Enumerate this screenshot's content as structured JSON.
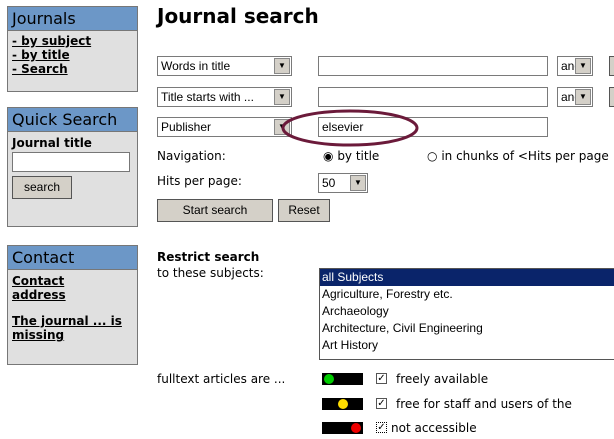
{
  "sidebar": {
    "journals_title": "Journals",
    "journals_links": [
      "- by subject",
      "- by title",
      "- Search"
    ],
    "quick_title": "Quick Search",
    "quick_label": "Journal title",
    "quick_button": "search",
    "contact_title": "Contact",
    "contact_link1": "Contact address",
    "contact_link2": "The journal ... is missing"
  },
  "main": {
    "title": "Journal search",
    "rows": [
      {
        "field": "Words in title",
        "value": "",
        "op": "and"
      },
      {
        "field": "Title starts with ...",
        "value": "",
        "op": "and"
      },
      {
        "field": "Publisher",
        "value": "elsevier"
      }
    ],
    "navigation_label": "Navigation:",
    "nav_option1": "by title",
    "nav_option2": "in chunks of <Hits per page",
    "hits_label": "Hits per page:",
    "hits_value": "50",
    "start_button": "Start search",
    "reset_button": "Reset",
    "restrict_heading": "Restrict search",
    "subjects_label": "to these subjects:",
    "subjects": [
      "all Subjects",
      "Agriculture, Forestry etc.",
      "Archaeology",
      "Architecture, Civil Engineering",
      "Art History"
    ],
    "fulltext_label": "fulltext articles are ...",
    "access": [
      {
        "label": "freely available",
        "color": "#00cc00"
      },
      {
        "label": "free for staff and users of the",
        "color": "#ffdd00"
      },
      {
        "label": "not accessible",
        "color": "#ee0000"
      }
    ],
    "highlight_color": "#6b1a3a"
  }
}
